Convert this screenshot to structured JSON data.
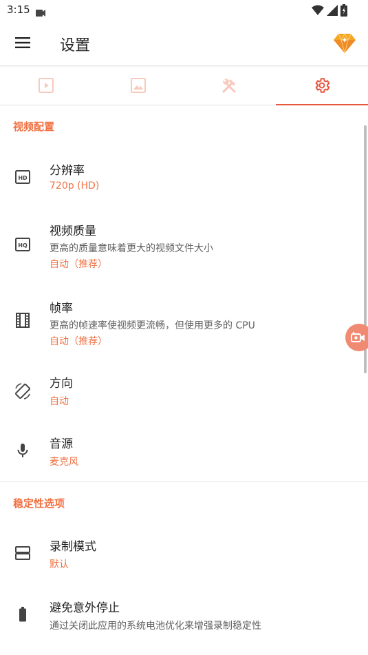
{
  "status_bar": {
    "time": "3:15"
  },
  "app_bar": {
    "title": "设置"
  },
  "tabs": [
    {
      "icon": "video-tab-icon",
      "active": false
    },
    {
      "icon": "image-tab-icon",
      "active": false
    },
    {
      "icon": "tools-tab-icon",
      "active": false
    },
    {
      "icon": "settings-tab-icon",
      "active": true
    }
  ],
  "sections": {
    "video": {
      "header": "视频配置",
      "resolution": {
        "title": "分辨率",
        "value": "720p (HD)"
      },
      "quality": {
        "title": "视频质量",
        "desc": "更高的质量意味着更大的视频文件大小",
        "value": "自动（推荐）"
      },
      "framerate": {
        "title": "帧率",
        "desc": "更高的帧速率使视频更流畅，但使用更多的 CPU",
        "value": "自动（推荐）"
      },
      "orientation": {
        "title": "方向",
        "value": "自动"
      },
      "audio": {
        "title": "音源",
        "value": "麦克风"
      }
    },
    "stability": {
      "header": "稳定性选项",
      "record_mode": {
        "title": "录制模式",
        "value": "默认"
      },
      "avoid_stop": {
        "title": "避免意外停止",
        "desc": "通过关闭此应用的系统电池优化来增强录制稳定性"
      }
    }
  },
  "colors": {
    "accent": "#f07245",
    "tab_indicator": "#e8573f"
  }
}
